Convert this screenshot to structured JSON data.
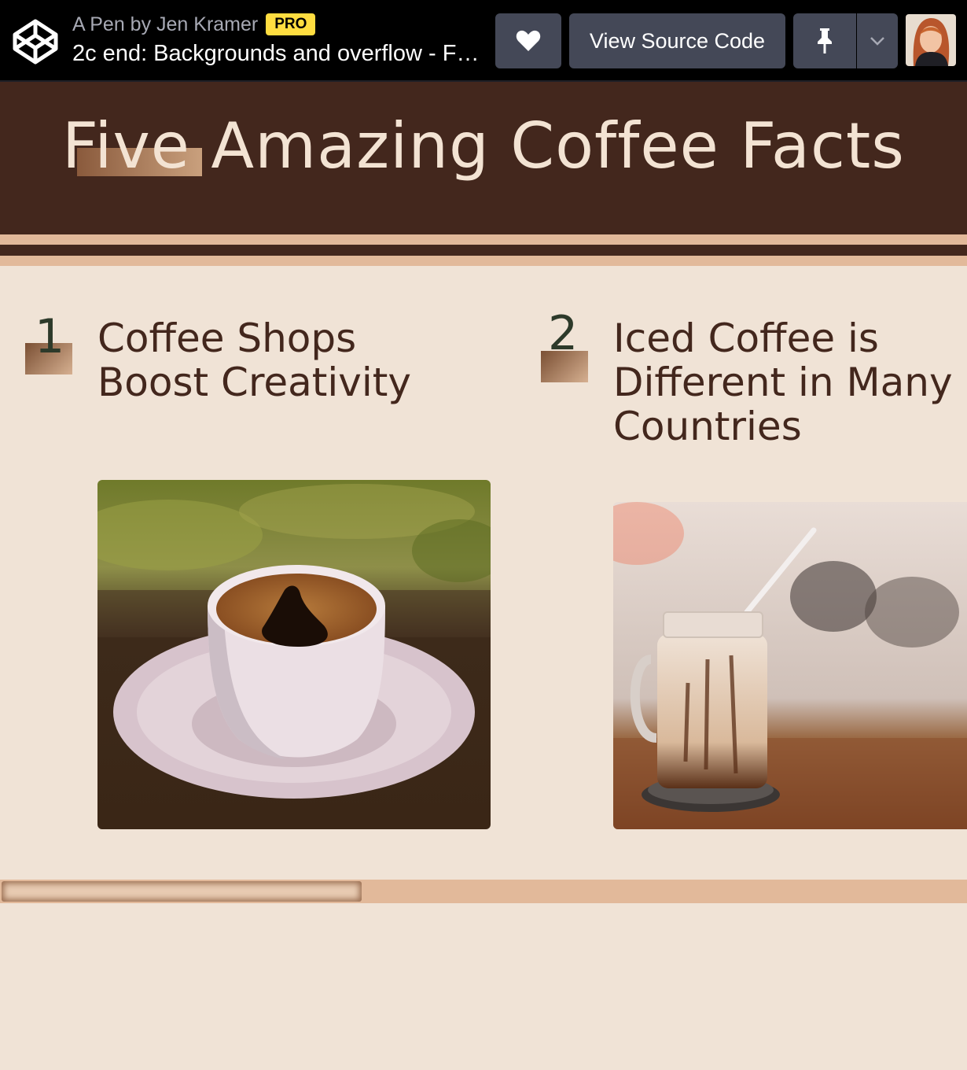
{
  "codepen": {
    "byline": "A Pen by Jen Kramer",
    "pro_badge": "PRO",
    "title": "2c end: Backgrounds and overflow - Five Amazing Coffee Facts",
    "view_source_label": "View Source Code",
    "icons": [
      "codepen-logo-icon",
      "heart-icon",
      "pin-icon",
      "chevron-down-icon",
      "avatar"
    ]
  },
  "page": {
    "title": "Five Amazing Coffee Facts"
  },
  "facts": [
    {
      "number": "1",
      "title": "Coffee Shops Boost Creativity",
      "image": "espresso cup on white saucer"
    },
    {
      "number": "2",
      "title": "Iced Coffee is Different in Many Countries",
      "image": "iced coffee in mason jar with straw"
    }
  ],
  "colors": {
    "topbar": "#000000",
    "button": "#444857",
    "pro": "#ffdd40",
    "header_bg": "#43271d",
    "header_text": "#f3e3d3",
    "page_bg": "#f0e3d6",
    "stripe": "#e2b99a",
    "number_text": "#2d3a2a"
  },
  "scrollbar": {
    "position_fraction": 0.0,
    "visible_fraction": 0.37
  }
}
